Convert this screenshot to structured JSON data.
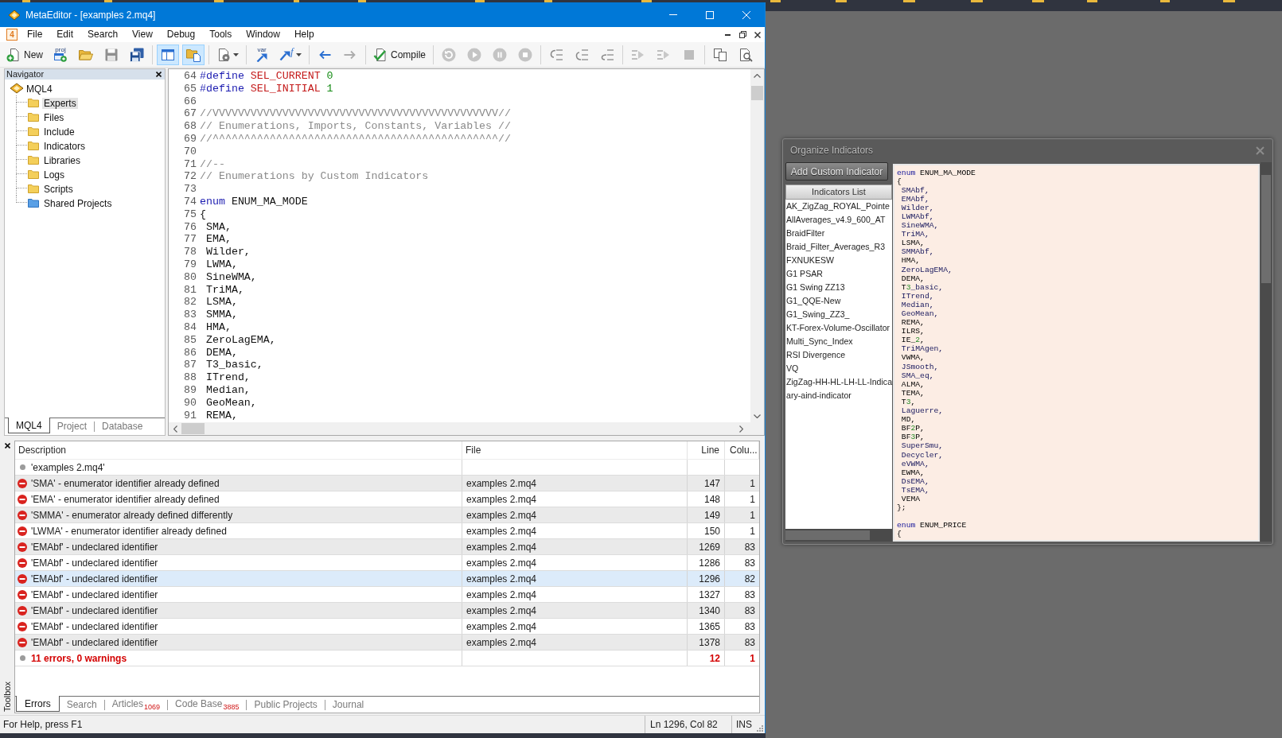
{
  "editor_window": {
    "title": "MetaEditor - [examples 2.mq4]",
    "system_menu": "4",
    "menu": [
      "File",
      "Edit",
      "Search",
      "View",
      "Debug",
      "Tools",
      "Window",
      "Help"
    ],
    "toolbar": {
      "groups": [
        [
          {
            "kind": "text",
            "label": "New",
            "pressed": false,
            "disabled": false,
            "dropdown": false
          },
          {
            "kind": "caption",
            "label": "proj",
            "pressed": false,
            "disabled": false,
            "dropdown": false
          },
          {
            "kind": "icon",
            "pressed": false,
            "disabled": false,
            "dropdown": false
          },
          {
            "kind": "icon",
            "pressed": false,
            "disabled": true,
            "dropdown": false
          },
          {
            "kind": "icon",
            "pressed": false,
            "disabled": false,
            "dropdown": false
          }
        ],
        [
          {
            "kind": "icon",
            "pressed": true,
            "disabled": false,
            "dropdown": false
          },
          {
            "kind": "icon",
            "pressed": true,
            "disabled": false,
            "dropdown": false
          }
        ],
        [
          {
            "kind": "icon",
            "pressed": false,
            "disabled": false,
            "dropdown": true
          }
        ],
        [
          {
            "kind": "caption",
            "label": "var",
            "pressed": false,
            "disabled": false,
            "dropdown": false
          },
          {
            "kind": "superscript",
            "label": "f",
            "pressed": false,
            "disabled": false,
            "dropdown": true
          }
        ],
        [
          {
            "kind": "icon",
            "pressed": false,
            "disabled": false,
            "dropdown": false
          },
          {
            "kind": "icon",
            "pressed": false,
            "disabled": true,
            "dropdown": false
          }
        ],
        [
          {
            "kind": "text",
            "label": "Compile",
            "pressed": false,
            "disabled": false,
            "dropdown": false
          }
        ],
        [
          {
            "kind": "icon",
            "pressed": false,
            "disabled": true,
            "dropdown": false
          },
          {
            "kind": "icon",
            "pressed": false,
            "disabled": true,
            "dropdown": false
          },
          {
            "kind": "icon",
            "pressed": false,
            "disabled": true,
            "dropdown": false
          },
          {
            "kind": "icon",
            "pressed": false,
            "disabled": true,
            "dropdown": false
          }
        ],
        [
          {
            "kind": "icon",
            "pressed": false,
            "disabled": true,
            "dropdown": false
          },
          {
            "kind": "icon",
            "pressed": false,
            "disabled": true,
            "dropdown": false
          },
          {
            "kind": "icon",
            "pressed": false,
            "disabled": true,
            "dropdown": false
          }
        ],
        [
          {
            "kind": "icon",
            "pressed": false,
            "disabled": true,
            "dropdown": false
          },
          {
            "kind": "icon",
            "pressed": false,
            "disabled": true,
            "dropdown": false
          },
          {
            "kind": "icon",
            "pressed": false,
            "disabled": true,
            "dropdown": false
          }
        ],
        [
          {
            "kind": "icon",
            "pressed": false,
            "disabled": false,
            "dropdown": false
          },
          {
            "kind": "icon",
            "pressed": false,
            "disabled": false,
            "dropdown": false
          }
        ]
      ]
    },
    "navigator": {
      "title": "Navigator",
      "tree": [
        {
          "label": "MQL4",
          "kind": "root",
          "selected": false,
          "children": [
            {
              "label": "Experts",
              "kind": "folder",
              "selected": true
            },
            {
              "label": "Files",
              "kind": "folder",
              "selected": false
            },
            {
              "label": "Include",
              "kind": "folder",
              "selected": false
            },
            {
              "label": "Indicators",
              "kind": "folder",
              "selected": false
            },
            {
              "label": "Libraries",
              "kind": "folder",
              "selected": false
            },
            {
              "label": "Logs",
              "kind": "folder",
              "selected": false
            },
            {
              "label": "Scripts",
              "kind": "folder",
              "selected": false
            },
            {
              "label": "Shared Projects",
              "kind": "shared",
              "selected": false
            }
          ]
        }
      ],
      "tabs": [
        {
          "label": "MQL4",
          "selected": true
        },
        {
          "label": "Project",
          "selected": false
        },
        {
          "label": "Database",
          "selected": false
        }
      ]
    },
    "code": {
      "lines": [
        {
          "number": "64",
          "tokens": [
            {
              "kind": "directive",
              "text": "#define "
            },
            {
              "kind": "constant",
              "text": "SEL_CURRENT "
            },
            {
              "kind": "number",
              "text": "0"
            }
          ]
        },
        {
          "number": "65",
          "tokens": [
            {
              "kind": "directive",
              "text": "#define "
            },
            {
              "kind": "constant",
              "text": "SEL_INITIAL "
            },
            {
              "kind": "number",
              "text": "1"
            }
          ]
        },
        {
          "number": "66"
        },
        {
          "number": "67",
          "tokens": [
            {
              "kind": "comment",
              "text": "//VVVVVVVVVVVVVVVVVVVVVVVVVVVVVVVVVVVVVVVVVVVVV//"
            }
          ]
        },
        {
          "number": "68",
          "tokens": [
            {
              "kind": "comment",
              "text": "// Enumerations, Imports, Constants, Variables //"
            }
          ]
        },
        {
          "number": "69",
          "tokens": [
            {
              "kind": "comment",
              "text": "//^^^^^^^^^^^^^^^^^^^^^^^^^^^^^^^^^^^^^^^^^^^^^//"
            }
          ]
        },
        {
          "number": "70"
        },
        {
          "number": "71",
          "tokens": [
            {
              "kind": "comment",
              "text": "//--"
            }
          ]
        },
        {
          "number": "72",
          "tokens": [
            {
              "kind": "comment",
              "text": "// Enumerations by Custom Indicators"
            }
          ]
        },
        {
          "number": "73"
        },
        {
          "number": "74",
          "tokens": [
            {
              "kind": "keyword",
              "text": "enum "
            },
            {
              "kind": "plain",
              "text": "ENUM_MA_MODE"
            }
          ]
        },
        {
          "number": "75",
          "tokens": [
            {
              "kind": "plain",
              "text": "{"
            }
          ]
        },
        {
          "number": "76",
          "tokens": [
            {
              "kind": "plain",
              "text": " SMA,"
            }
          ]
        },
        {
          "number": "77",
          "tokens": [
            {
              "kind": "plain",
              "text": " EMA,"
            }
          ]
        },
        {
          "number": "78",
          "tokens": [
            {
              "kind": "plain",
              "text": " Wilder,"
            }
          ]
        },
        {
          "number": "79",
          "tokens": [
            {
              "kind": "plain",
              "text": " LWMA,"
            }
          ]
        },
        {
          "number": "80",
          "tokens": [
            {
              "kind": "plain",
              "text": " SineWMA,"
            }
          ]
        },
        {
          "number": "81",
          "tokens": [
            {
              "kind": "plain",
              "text": " TriMA,"
            }
          ]
        },
        {
          "number": "82",
          "tokens": [
            {
              "kind": "plain",
              "text": " LSMA,"
            }
          ]
        },
        {
          "number": "83",
          "tokens": [
            {
              "kind": "plain",
              "text": " SMMA,"
            }
          ]
        },
        {
          "number": "84",
          "tokens": [
            {
              "kind": "plain",
              "text": " HMA,"
            }
          ]
        },
        {
          "number": "85",
          "tokens": [
            {
              "kind": "plain",
              "text": " ZeroLagEMA,"
            }
          ]
        },
        {
          "number": "86",
          "tokens": [
            {
              "kind": "plain",
              "text": " DEMA,"
            }
          ]
        },
        {
          "number": "87",
          "tokens": [
            {
              "kind": "plain",
              "text": " T3_basic,"
            }
          ]
        },
        {
          "number": "88",
          "tokens": [
            {
              "kind": "plain",
              "text": " ITrend,"
            }
          ]
        },
        {
          "number": "89",
          "tokens": [
            {
              "kind": "plain",
              "text": " Median,"
            }
          ]
        },
        {
          "number": "90",
          "tokens": [
            {
              "kind": "plain",
              "text": " GeoMean,"
            }
          ]
        },
        {
          "number": "91",
          "tokens": [
            {
              "kind": "plain",
              "text": " REMA,"
            }
          ]
        }
      ]
    },
    "toolbox": {
      "label": "Toolbox",
      "columns": [
        "Description",
        "File",
        "Line",
        "Colu..."
      ],
      "rows": [
        {
          "kind": "file",
          "description": "'examples 2.mq4'",
          "selected": false
        },
        {
          "kind": "error",
          "description": "'SMA' - enumerator identifier already defined",
          "file": "examples 2.mq4",
          "line": "147",
          "column": "1",
          "selected": false
        },
        {
          "kind": "error",
          "description": "'EMA' - enumerator identifier already defined",
          "file": "examples 2.mq4",
          "line": "148",
          "column": "1",
          "selected": false
        },
        {
          "kind": "error",
          "description": "'SMMA' - enumerator already defined differently",
          "file": "examples 2.mq4",
          "line": "149",
          "column": "1",
          "selected": false
        },
        {
          "kind": "error",
          "description": "'LWMA' - enumerator identifier already defined",
          "file": "examples 2.mq4",
          "line": "150",
          "column": "1",
          "selected": false
        },
        {
          "kind": "error",
          "description": "'EMAbf' - undeclared identifier",
          "file": "examples 2.mq4",
          "line": "1269",
          "column": "83",
          "selected": false
        },
        {
          "kind": "error",
          "description": "'EMAbf' - undeclared identifier",
          "file": "examples 2.mq4",
          "line": "1286",
          "column": "83",
          "selected": false
        },
        {
          "kind": "error",
          "description": "'EMAbf' - undeclared identifier",
          "file": "examples 2.mq4",
          "line": "1296",
          "column": "82",
          "selected": true
        },
        {
          "kind": "error",
          "description": "'EMAbf' - undeclared identifier",
          "file": "examples 2.mq4",
          "line": "1327",
          "column": "83",
          "selected": false
        },
        {
          "kind": "error",
          "description": "'EMAbf' - undeclared identifier",
          "file": "examples 2.mq4",
          "line": "1340",
          "column": "83",
          "selected": false
        },
        {
          "kind": "error",
          "description": "'EMAbf' - undeclared identifier",
          "file": "examples 2.mq4",
          "line": "1365",
          "column": "83",
          "selected": false
        },
        {
          "kind": "error",
          "description": "'EMAbf' - undeclared identifier",
          "file": "examples 2.mq4",
          "line": "1378",
          "column": "83",
          "selected": false
        },
        {
          "kind": "summary",
          "description": "11 errors, 0 warnings",
          "line": "12",
          "column": "1",
          "selected": false
        }
      ],
      "tabs": [
        {
          "label": "Errors",
          "selected": true
        },
        {
          "label": "Search",
          "selected": false
        },
        {
          "label": "Articles",
          "badge": "1069",
          "selected": false
        },
        {
          "label": "Code Base",
          "badge": "3885",
          "selected": false
        },
        {
          "label": "Public Projects",
          "selected": false
        },
        {
          "label": "Journal",
          "selected": false
        }
      ]
    },
    "status_bar": {
      "message": "For Help, press F1",
      "position": "Ln 1296, Col 82",
      "mode": "INS"
    }
  },
  "organize_indicators": {
    "title": "Organize Indicators",
    "add_button": "Add Custom Indicator",
    "list_header": "Indicators List",
    "indicators": [
      "AK_ZigZag_ROYAL_Pointe",
      "AllAverages_v4.9_600_AT",
      "BraidFilter",
      "Braid_Filter_Averages_R3",
      "FXNUKESW",
      "G1 PSAR",
      "G1 Swing ZZ13",
      "G1_QQE-New",
      "G1_Swing_ZZ3_",
      "KT-Forex-Volume-Oscillator",
      "Multi_Sync_Index",
      "RSI Divergence",
      "VQ",
      "ZigZag-HH-HL-LH-LL-Indica",
      "ary-aind-indicator"
    ],
    "code_blocks": [
      {
        "lines": [
          {
            "tokens": [
              {
                "kind": "keyword",
                "text": "enum "
              },
              {
                "kind": "plain",
                "text": "ENUM_MA_MODE"
              }
            ]
          },
          {
            "tokens": [
              {
                "kind": "plain",
                "text": "{"
              }
            ]
          },
          {
            "tokens": [
              {
                "kind": "ident",
                "text": " SMAbf,"
              }
            ]
          },
          {
            "tokens": [
              {
                "kind": "ident",
                "text": " EMAbf,"
              }
            ]
          },
          {
            "tokens": [
              {
                "kind": "ident",
                "text": " Wilder,"
              }
            ]
          },
          {
            "tokens": [
              {
                "kind": "ident",
                "text": " LWMAbf,"
              }
            ]
          },
          {
            "tokens": [
              {
                "kind": "ident",
                "text": " SineWMA,"
              }
            ]
          },
          {
            "tokens": [
              {
                "kind": "ident",
                "text": " TriMA,"
              }
            ]
          },
          {
            "tokens": [
              {
                "kind": "plain",
                "text": " LSMA,"
              }
            ]
          },
          {
            "tokens": [
              {
                "kind": "ident",
                "text": " SMMAbf,"
              }
            ]
          },
          {
            "tokens": [
              {
                "kind": "plain",
                "text": " HMA,"
              }
            ]
          },
          {
            "tokens": [
              {
                "kind": "ident",
                "text": " ZeroLagEMA,"
              }
            ]
          },
          {
            "tokens": [
              {
                "kind": "plain",
                "text": " DEMA,"
              }
            ]
          },
          {
            "tokens": [
              {
                "kind": "plain",
                "text": " T"
              },
              {
                "kind": "number",
                "text": "3"
              },
              {
                "kind": "ident",
                "text": "_basic,"
              }
            ]
          },
          {
            "tokens": [
              {
                "kind": "ident",
                "text": " ITrend,"
              }
            ]
          },
          {
            "tokens": [
              {
                "kind": "ident",
                "text": " Median,"
              }
            ]
          },
          {
            "tokens": [
              {
                "kind": "ident",
                "text": " GeoMean,"
              }
            ]
          },
          {
            "tokens": [
              {
                "kind": "plain",
                "text": " REMA,"
              }
            ]
          },
          {
            "tokens": [
              {
                "kind": "plain",
                "text": " ILRS,"
              }
            ]
          },
          {
            "tokens": [
              {
                "kind": "plain",
                "text": " IE_"
              },
              {
                "kind": "number",
                "text": "2"
              },
              {
                "kind": "plain",
                "text": ","
              }
            ]
          },
          {
            "tokens": [
              {
                "kind": "ident",
                "text": " TriMAgen,"
              }
            ]
          },
          {
            "tokens": [
              {
                "kind": "plain",
                "text": " VWMA,"
              }
            ]
          },
          {
            "tokens": [
              {
                "kind": "ident",
                "text": " JSmooth,"
              }
            ]
          },
          {
            "tokens": [
              {
                "kind": "ident",
                "text": " SMA_eq,"
              }
            ]
          },
          {
            "tokens": [
              {
                "kind": "plain",
                "text": " ALMA,"
              }
            ]
          },
          {
            "tokens": [
              {
                "kind": "plain",
                "text": " TEMA,"
              }
            ]
          },
          {
            "tokens": [
              {
                "kind": "plain",
                "text": " T"
              },
              {
                "kind": "number",
                "text": "3"
              },
              {
                "kind": "plain",
                "text": ","
              }
            ]
          },
          {
            "tokens": [
              {
                "kind": "ident",
                "text": " Laguerre,"
              }
            ]
          },
          {
            "tokens": [
              {
                "kind": "plain",
                "text": " MD,"
              }
            ]
          },
          {
            "tokens": [
              {
                "kind": "plain",
                "text": " BF"
              },
              {
                "kind": "number",
                "text": "2"
              },
              {
                "kind": "plain",
                "text": "P,"
              }
            ]
          },
          {
            "tokens": [
              {
                "kind": "plain",
                "text": " BF"
              },
              {
                "kind": "number",
                "text": "3"
              },
              {
                "kind": "plain",
                "text": "P,"
              }
            ]
          },
          {
            "tokens": [
              {
                "kind": "ident",
                "text": " SuperSmu,"
              }
            ]
          },
          {
            "tokens": [
              {
                "kind": "ident",
                "text": " Decycler,"
              }
            ]
          },
          {
            "tokens": [
              {
                "kind": "ident",
                "text": " eVWMA,"
              }
            ]
          },
          {
            "tokens": [
              {
                "kind": "plain",
                "text": " EWMA,"
              }
            ]
          },
          {
            "tokens": [
              {
                "kind": "ident",
                "text": " DsEMA,"
              }
            ]
          },
          {
            "tokens": [
              {
                "kind": "ident",
                "text": " TsEMA,"
              }
            ]
          },
          {
            "tokens": [
              {
                "kind": "plain",
                "text": " VEMA"
              }
            ]
          },
          {
            "tokens": [
              {
                "kind": "plain",
                "text": "};"
              }
            ]
          }
        ]
      },
      {
        "lines": [
          {
            "tokens": [
              {
                "kind": "keyword",
                "text": "enum "
              },
              {
                "kind": "plain",
                "text": "ENUM_PRICE"
              }
            ]
          },
          {
            "tokens": [
              {
                "kind": "plain",
                "text": "{"
              }
            ]
          }
        ]
      }
    ]
  }
}
